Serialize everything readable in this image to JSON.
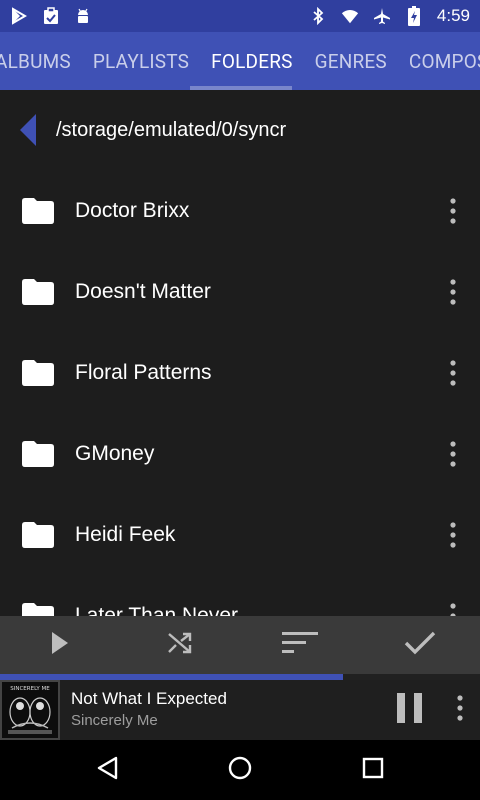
{
  "status_bar": {
    "time": "4:59",
    "left_icons": [
      "play-store-icon",
      "clipboard-icon",
      "android-icon"
    ],
    "right_icons": [
      "bluetooth-icon",
      "wifi-icon",
      "airplane-icon",
      "battery-charging-icon"
    ]
  },
  "tabs": [
    {
      "label": "ALBUMS",
      "active": false
    },
    {
      "label": "PLAYLISTS",
      "active": false
    },
    {
      "label": "FOLDERS",
      "active": true
    },
    {
      "label": "GENRES",
      "active": false
    },
    {
      "label": "COMPOSERS",
      "active": false
    }
  ],
  "path": {
    "back_icon": "back-triangle-icon",
    "text": "/storage/emulated/0/syncr"
  },
  "folders": [
    {
      "name": "Doctor Brixx"
    },
    {
      "name": "Doesn't Matter"
    },
    {
      "name": "Floral Patterns"
    },
    {
      "name": "GMoney"
    },
    {
      "name": "Heidi Feek"
    },
    {
      "name": "Later Than Never"
    }
  ],
  "actions": [
    "play-icon",
    "shuffle-icon",
    "sort-icon",
    "select-check-icon"
  ],
  "now_playing": {
    "title": "Not What I Expected",
    "artist": "Sincerely Me",
    "progress_fraction": 0.715,
    "album_art_text": "SINCERELY ME"
  },
  "nav": [
    "back-icon",
    "home-icon",
    "recents-icon"
  ],
  "colors": {
    "primary": "#3f51b5",
    "primary_dark": "#303f9f",
    "indicator": "#7986cb",
    "content_bg": "#1d1d1d",
    "action_bar_bg": "#3a3a3a"
  }
}
